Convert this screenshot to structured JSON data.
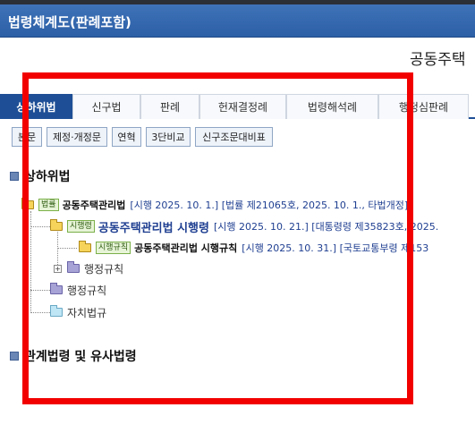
{
  "window": {
    "title": "법령체계도(판례포함)"
  },
  "law_header": "공동주택",
  "tabs": [
    {
      "label": "상하위법",
      "active": true
    },
    {
      "label": "신구법"
    },
    {
      "label": "판례"
    },
    {
      "label": "헌재결정례"
    },
    {
      "label": "법령해석례"
    },
    {
      "label": "행정심판례"
    }
  ],
  "sub_buttons": [
    "본문",
    "제정·개정문",
    "연혁",
    "3단비교",
    "신구조문대비표"
  ],
  "section_hierarchy": {
    "title": "상하위법"
  },
  "tree": {
    "law": {
      "badge": "법률",
      "name": "공동주택관리법",
      "meta": "[시행 2025. 10. 1.] [법률 제21065호, 2025. 10. 1., 타법개정]"
    },
    "decree": {
      "badge": "시행령",
      "name": "공동주택관리법 시행령",
      "meta": "[시행 2025. 10. 21.] [대통령령 제35823호, 2025."
    },
    "rule": {
      "badge": "시행규칙",
      "name": "공동주택관리법 시행규칙",
      "meta": "[시행 2025. 10. 31.] [국토교통부령 제153"
    },
    "admin_rules_sub": {
      "label": "행정규칙"
    },
    "admin_rules": {
      "label": "행정규칙"
    },
    "local_laws": {
      "label": "자치법규"
    }
  },
  "section_related": {
    "title": "관계법령 및 유사법령"
  },
  "colors": {
    "highlight_box": "#f20000",
    "accent": "#1e4f96"
  }
}
